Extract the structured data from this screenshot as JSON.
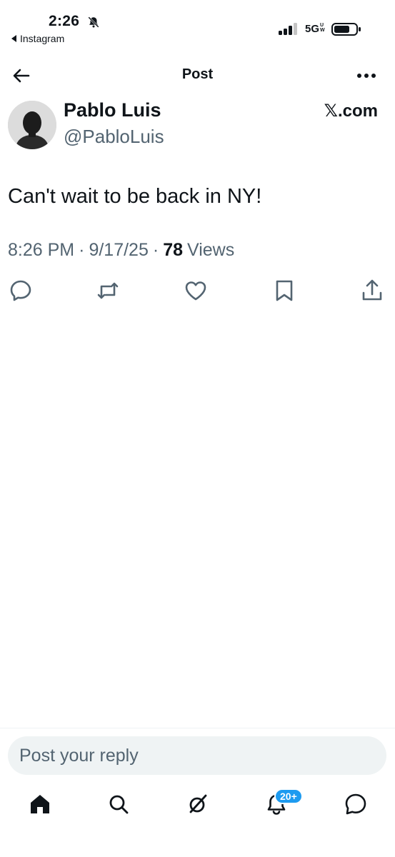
{
  "status_bar": {
    "time": "2:26",
    "back_app": "Instagram",
    "network": "5G",
    "network_sub_top": "U",
    "network_sub_bottom": "W"
  },
  "header": {
    "title": "Post"
  },
  "post": {
    "author_name": "Pablo Luis",
    "author_handle": "@PabloLuis",
    "source_x": "𝕏",
    "source_domain": ".com",
    "text": "Can't wait to be back in NY!",
    "time": "8:26 PM",
    "date": "9/17/25",
    "views_count": "78",
    "views_label": "Views"
  },
  "reply": {
    "placeholder": "Post your reply"
  },
  "tab_bar": {
    "notification_badge": "20+"
  },
  "colors": {
    "text_primary": "#0f1419",
    "text_secondary": "#536471",
    "accent": "#1d9bf0",
    "input_bg": "#eff3f4"
  },
  "icons": [
    "bell-off-icon",
    "signal-icon",
    "battery-icon",
    "back-arrow-icon",
    "more-icon",
    "reply-icon",
    "repost-icon",
    "like-icon",
    "bookmark-icon",
    "share-icon",
    "home-icon",
    "search-icon",
    "grok-icon",
    "notifications-icon",
    "messages-icon"
  ]
}
